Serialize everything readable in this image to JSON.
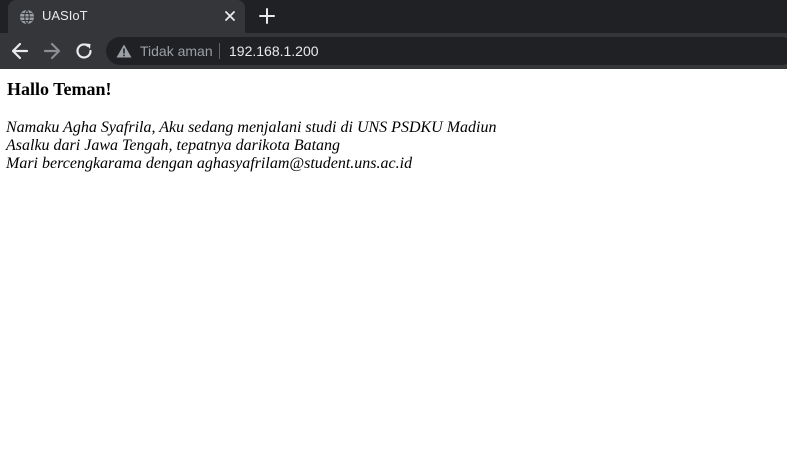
{
  "browser": {
    "tab": {
      "title": "UASIoT",
      "favicon": "globe-icon",
      "close_icon": "close-icon"
    },
    "new_tab_icon": "plus-icon",
    "nav": {
      "back_icon": "arrow-left-icon",
      "forward_icon": "arrow-right-icon",
      "reload_icon": "reload-icon"
    },
    "omnibox": {
      "security_icon": "warning-triangle-icon",
      "security_label": "Tidak aman",
      "url": "192.168.1.200"
    },
    "colors": {
      "tabstrip": "#202124",
      "active_tab": "#35363a",
      "omnibox": "#202124",
      "text": "#e8eaed",
      "muted_text": "#9aa0a6"
    }
  },
  "page": {
    "heading": "Hallo Teman!",
    "lines": [
      "Namaku Agha Syafrila, Aku sedang menjalani studi di UNS PSDKU Madiun",
      "Asalku dari Jawa Tengah, tepatnya darikota Batang",
      "Mari bercengkarama dengan aghasyafrilam@student.uns.ac.id"
    ]
  }
}
